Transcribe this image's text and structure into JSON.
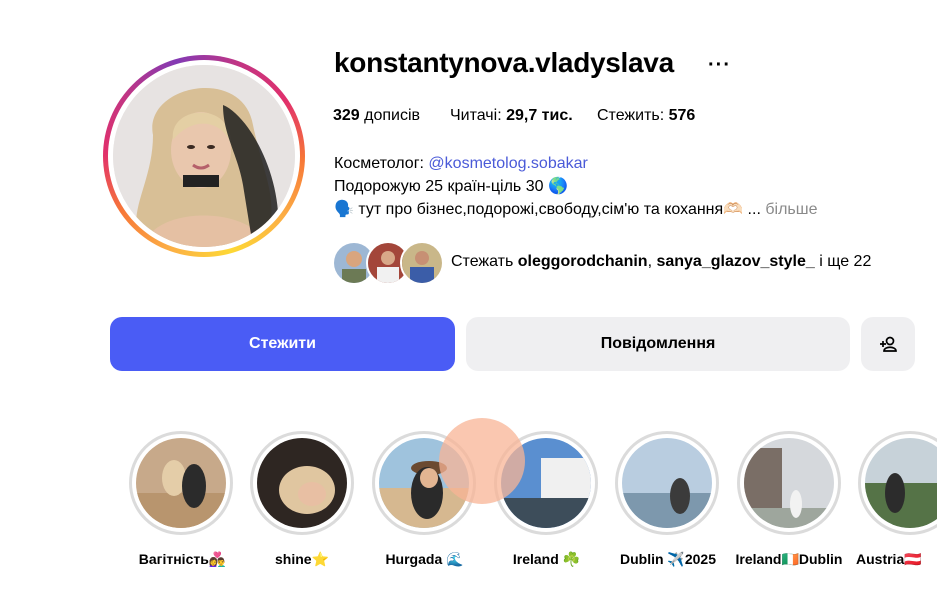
{
  "profile": {
    "username": "konstantynova.vladyslava",
    "more_icon": "more-horizontal-icon"
  },
  "stats": {
    "posts_count": "329",
    "posts_label": "дописів",
    "followers_label": "Читачі:",
    "followers_count": "29,7 тис.",
    "following_label": "Стежить:",
    "following_count": "576"
  },
  "bio": {
    "line1_prefix": "Косметолог: ",
    "line1_mention": "@kosmetolog.sobakar",
    "line2": "Подорожую 25 країн-ціль 30",
    "line2_emoji": "🌎",
    "line3_emoji": "🗣️",
    "line3": "тут про бізнес,подорожі,свободу,сім'ю та кохання",
    "line3_emoji_end": "🫶🏻",
    "ellipsis": "...",
    "more_label": "більше"
  },
  "followed_by": {
    "prefix": "Стежать ",
    "user1": "oleggorodchanin",
    "separator": ", ",
    "user2": "sanya_glazov_style_",
    "suffix": " і ще 22"
  },
  "buttons": {
    "follow_label": "Стежити",
    "message_label": "Повідомлення",
    "add_friend_icon": "person-add-icon"
  },
  "highlights": [
    {
      "label": "Вагітність👩‍❤️‍👨"
    },
    {
      "label": "shine⭐"
    },
    {
      "label": "Hurgada 🌊"
    },
    {
      "label": "Ireland ☘️"
    },
    {
      "label": "Dublin ✈️2025"
    },
    {
      "label": "Ireland🇮🇪Dublin"
    },
    {
      "label": "Austria🇦🇹"
    }
  ],
  "colors": {
    "accent": "#4a5cf5",
    "link": "#4a5ad8",
    "secondary_button": "#efeff1"
  }
}
